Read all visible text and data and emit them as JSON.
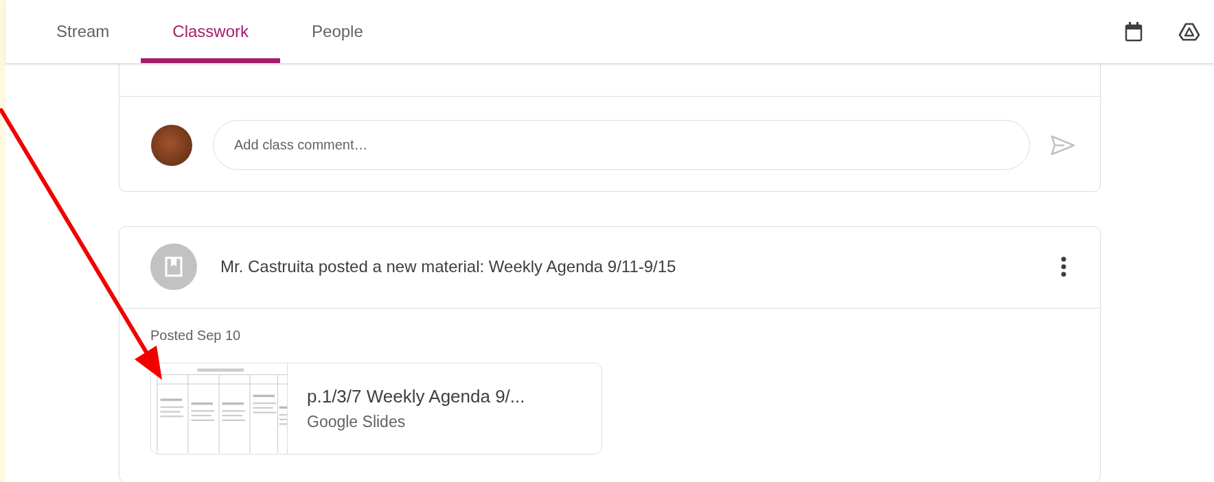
{
  "tabs": [
    {
      "label": "Stream",
      "selected": false
    },
    {
      "label": "Classwork",
      "selected": true
    },
    {
      "label": "People",
      "selected": false
    }
  ],
  "comment_box": {
    "placeholder": "Add class comment…"
  },
  "post": {
    "header": "Mr. Castruita posted a new material: Weekly Agenda 9/11-9/15",
    "posted": "Posted Sep 10",
    "attachment": {
      "title": "p.1/3/7 Weekly Agenda 9/...",
      "type": "Google Slides"
    }
  }
}
